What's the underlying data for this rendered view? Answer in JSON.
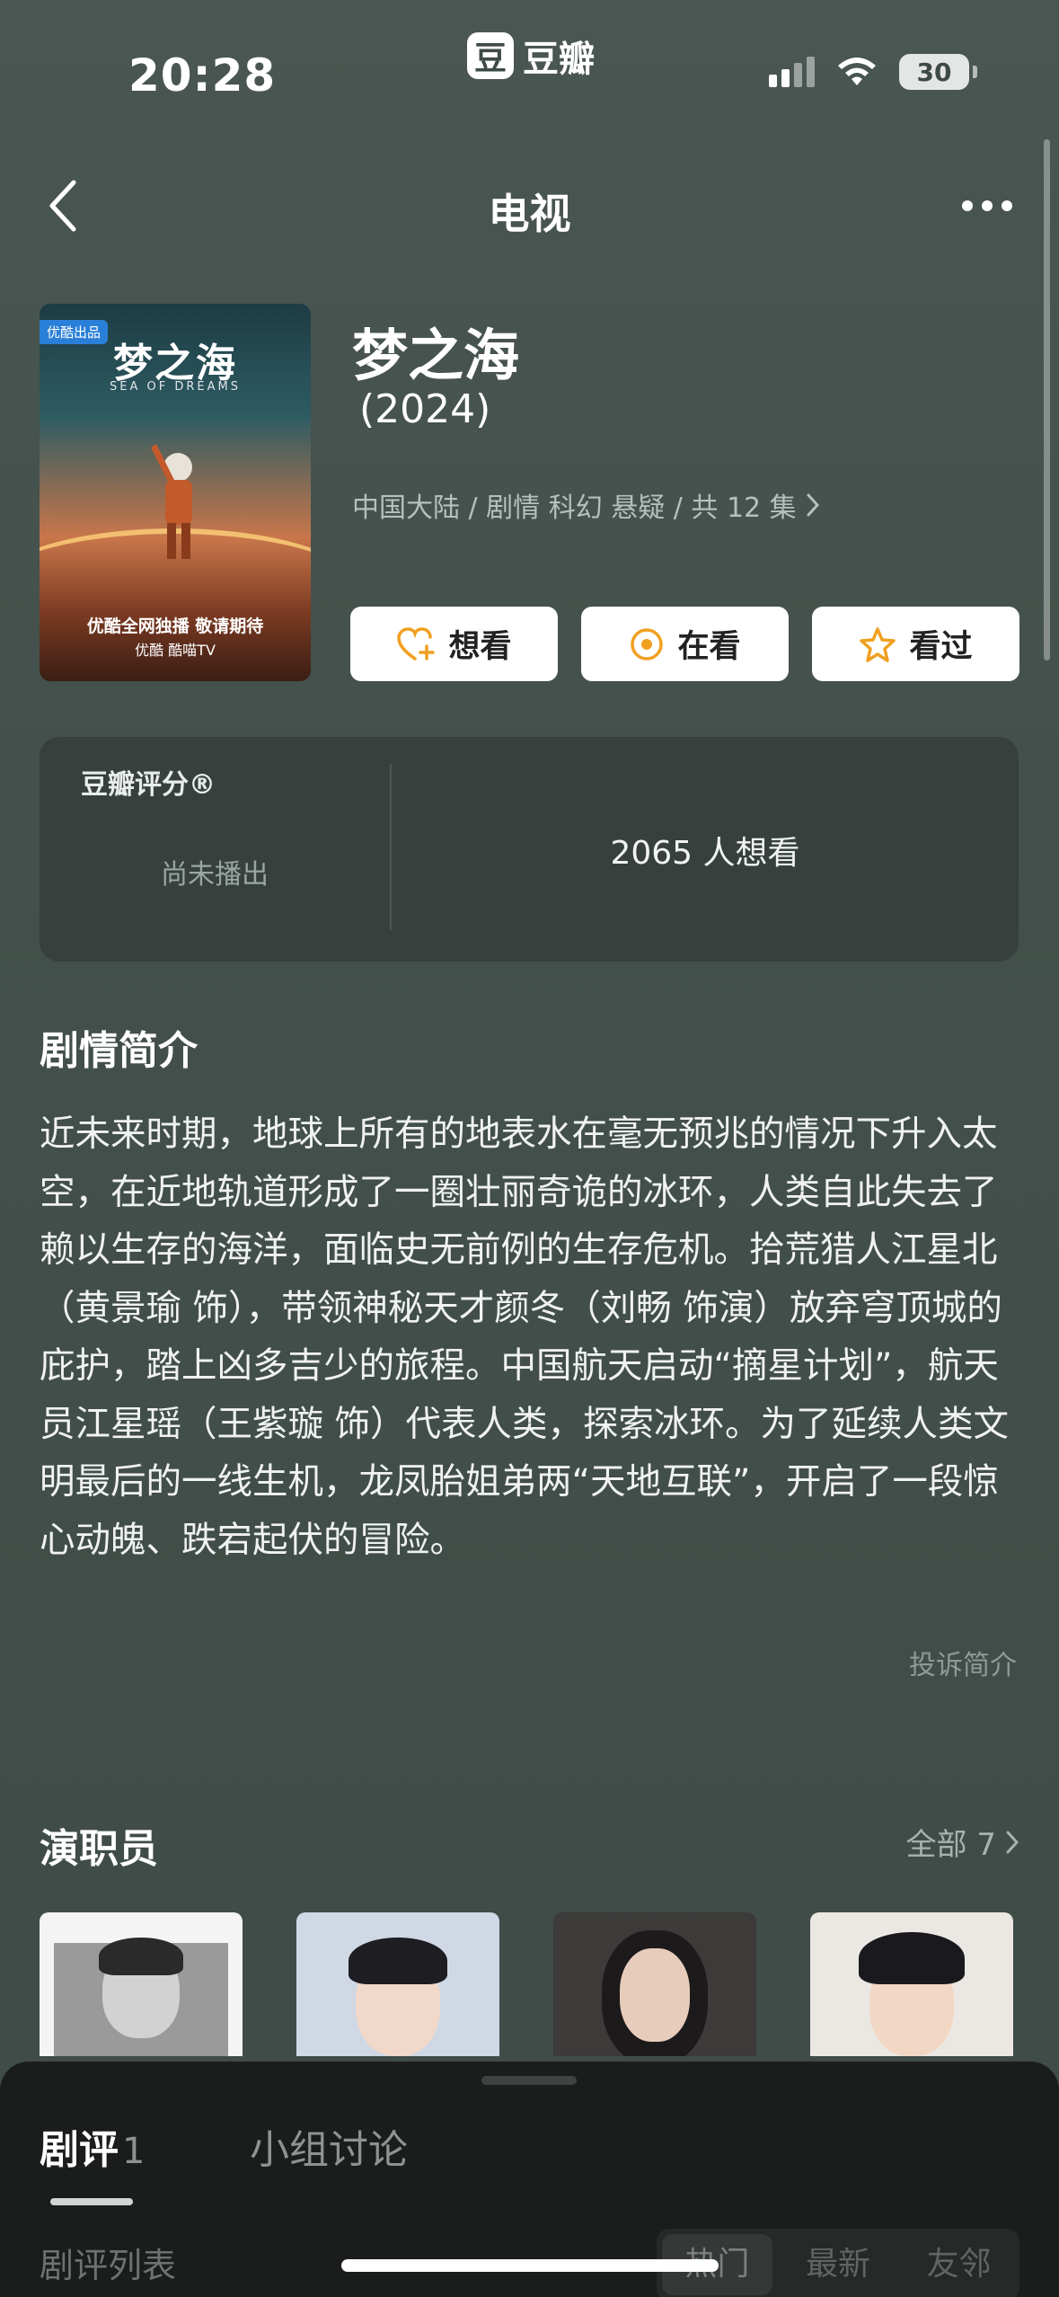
{
  "status_bar": {
    "time": "20:28",
    "brand_glyph": "豆",
    "brand_name": "豆瓣",
    "battery": "30"
  },
  "nav": {
    "title": "电视"
  },
  "show": {
    "title": "梦之海",
    "year": "(2024)",
    "meta": "中国大陆 / 剧情 科幻 悬疑 / 共 12 集",
    "poster": {
      "tag": "优酷出品",
      "title": "梦之海",
      "subtitle": "SEA OF DREAMS",
      "tagline": "优酷全网独播 敬请期待",
      "platforms": "优酷  酷喵TV"
    }
  },
  "actions": {
    "want": "想看",
    "watching": "在看",
    "watched": "看过"
  },
  "rating": {
    "label": "豆瓣评分®",
    "status": "尚未播出",
    "want_count": "2065 人想看"
  },
  "synopsis": {
    "title": "剧情简介",
    "text": "近未来时期，地球上所有的地表水在毫无预兆的情况下升入太空，在近地轨道形成了一圈壮丽奇诡的冰环，人类自此失去了赖以生存的海洋，面临史无前例的生存危机。拾荒猎人江星北（黄景瑜 饰），带领神秘天才颜冬（刘畅 饰演）放弃穹顶城的庇护，踏上凶多吉少的旅程。中国航天启动“摘星计划”，航天员江星瑶（王紫璇 饰）代表人类，探索冰环。为了延续人类文明最后的一线生机，龙凤胎姐弟两“天地互联”，开启了一段惊心动魄、跌宕起伏的冒险。",
    "report": "投诉简介"
  },
  "cast": {
    "title": "演职员",
    "all": "全部 7"
  },
  "sheet": {
    "tab_review": "剧评",
    "tab_review_count": "1",
    "tab_group": "小组讨论",
    "list_label": "剧评列表",
    "sort_options": [
      "热门",
      "最新",
      "友邻"
    ]
  },
  "colors": {
    "accent_orange": "#f0a020",
    "background": "#43504b",
    "card": "#37403d"
  }
}
